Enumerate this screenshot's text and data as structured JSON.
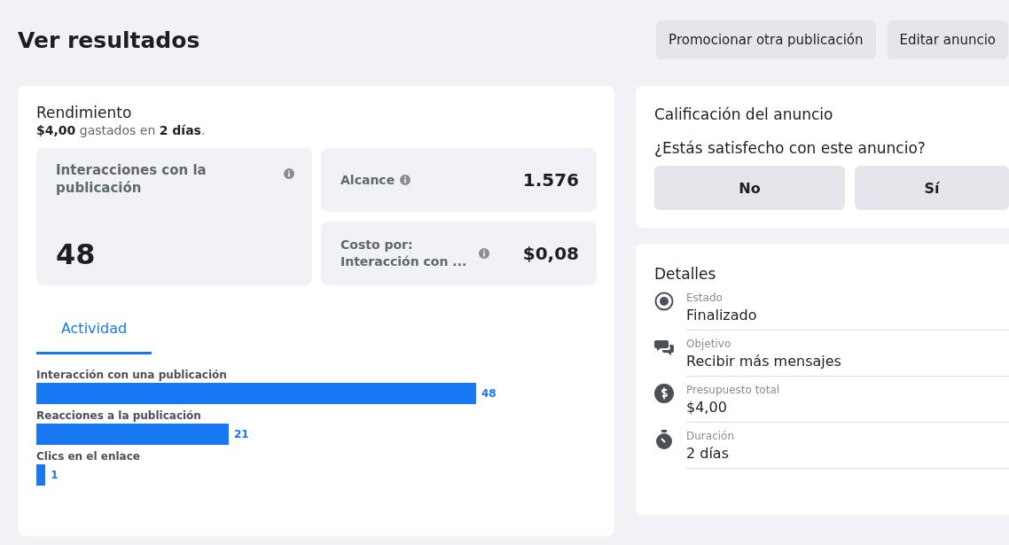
{
  "header": {
    "title": "Ver resultados",
    "buttons": [
      "Promocionar otra publicación",
      "Editar anuncio"
    ]
  },
  "performance": {
    "title": "Rendimiento",
    "summary": "**$4,00** gastados en **2 días**.",
    "main_stat": {
      "label": "Interacciones con la publicación",
      "value": "48"
    },
    "stats": [
      {
        "label": "Alcance",
        "value": "1.576"
      },
      {
        "label": "Costo por: Interacción con ...",
        "value": "$0,08"
      }
    ],
    "tabs": [
      {
        "label": "Actividad",
        "selected": true
      }
    ],
    "chart_data": {
      "type": "bar",
      "orientation": "horizontal",
      "categories": [
        "Interacción con una publicación",
        "Reacciones a la publicación",
        "Clics en el enlace"
      ],
      "values": [
        48,
        21,
        1
      ],
      "data_labels": true
    }
  },
  "rating": {
    "title": "Calificación del anuncio",
    "question": "¿Estás satisfecho con este anuncio?",
    "buttons": [
      "No",
      "Sí"
    ]
  },
  "details": {
    "title": "Detalles",
    "items": [
      {
        "kind": "status",
        "label": "Estado",
        "value": "Finalizado"
      },
      {
        "kind": "objective",
        "label": "Objetivo",
        "value": "Recibir más mensajes"
      },
      {
        "kind": "budget",
        "label": "Presupuesto total",
        "value": "$4,00"
      },
      {
        "kind": "duration",
        "label": "Duración",
        "value": "2 días"
      }
    ]
  }
}
